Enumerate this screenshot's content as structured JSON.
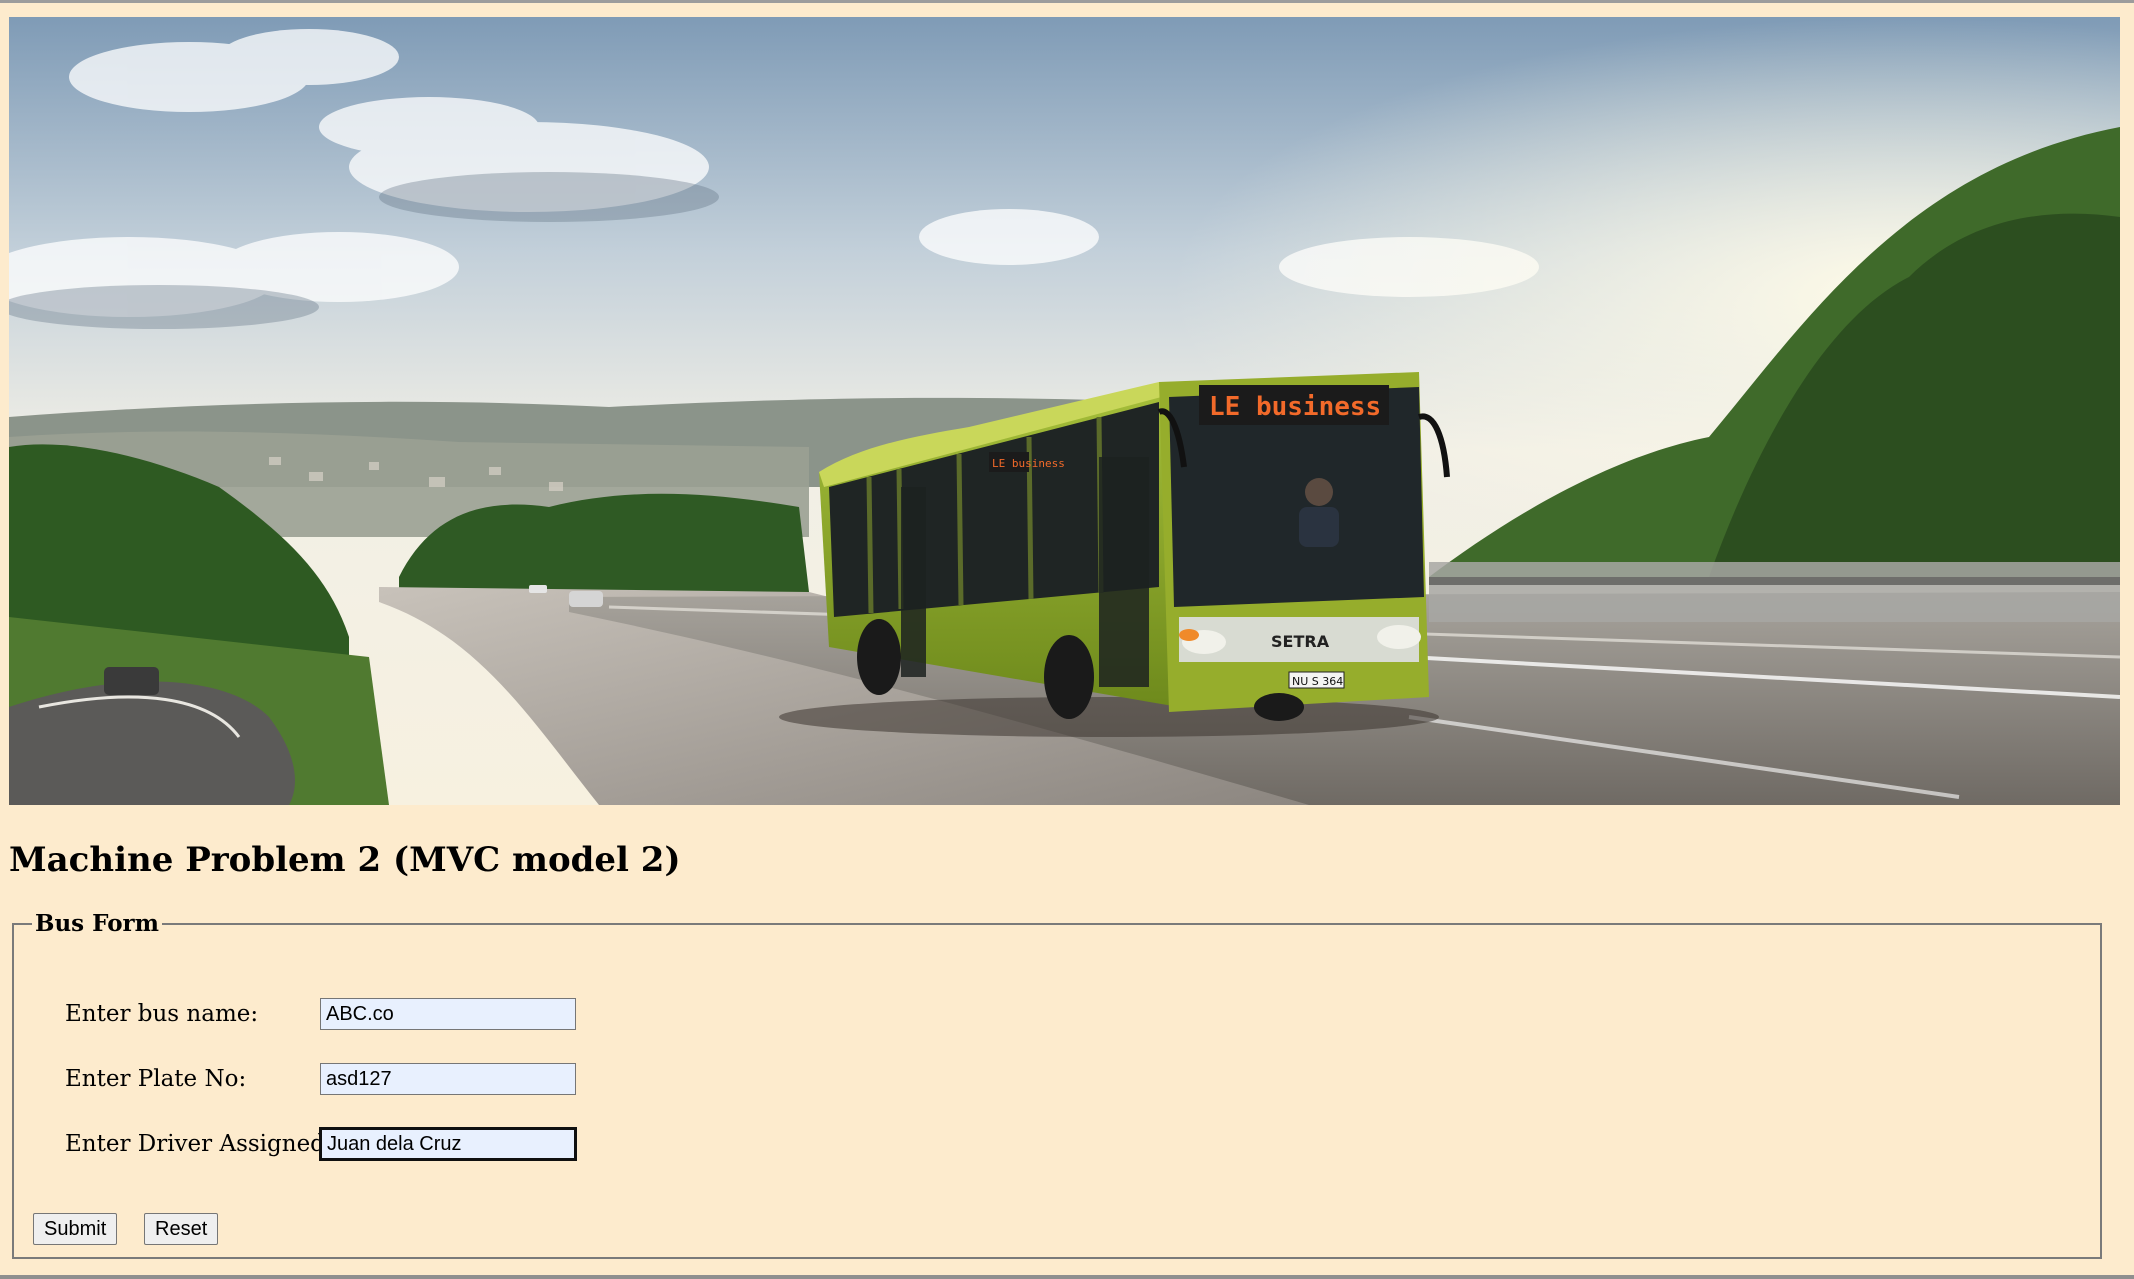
{
  "page": {
    "heading": "Machine Problem 2 (MVC model 2)"
  },
  "banner": {
    "bus_sign_text": "LE business",
    "bus_side_sign_text": "LE business",
    "bus_brand": "SETRA",
    "plate_text": "NU S 364"
  },
  "form": {
    "legend": "Bus Form",
    "fields": [
      {
        "label": "Enter bus name:",
        "value": "ABC.co"
      },
      {
        "label": "Enter Plate No:",
        "value": "asd127"
      },
      {
        "label": "Enter Driver Assigned:",
        "value": "Juan dela Cruz"
      }
    ],
    "submit_label": "Submit",
    "reset_label": "Reset"
  },
  "colors": {
    "page_background": "#fdebcd",
    "input_background": "#e8f0fe",
    "bus_body": "#8aa52a"
  }
}
